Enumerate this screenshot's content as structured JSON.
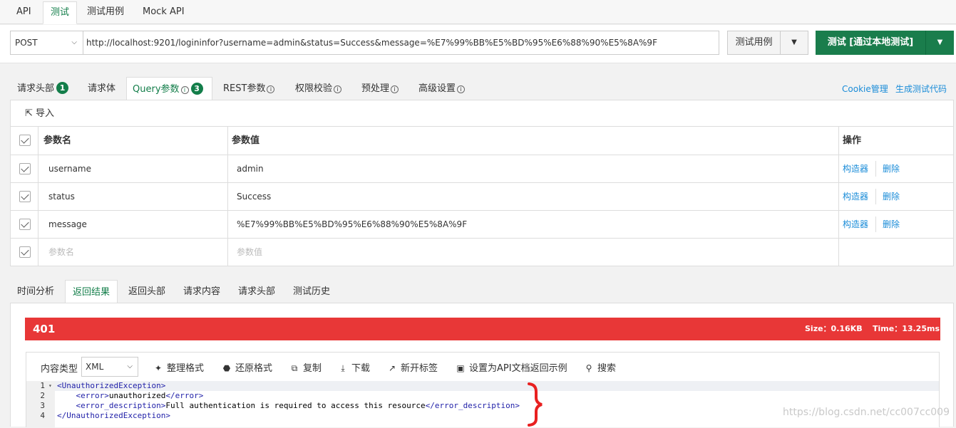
{
  "top_tabs": [
    "API",
    "测试",
    "测试用例",
    "Mock API"
  ],
  "request": {
    "method": "POST",
    "url": "http://localhost:9201/logininfor?username=admin&status=Success&message=%E7%99%BB%E5%BD%95%E6%88%90%E5%8A%9F",
    "test_cases_label": "测试用例",
    "test_button_label": "测试 [通过本地测试]"
  },
  "req_tabs": {
    "headers": "请求头部",
    "headers_count": "1",
    "body": "请求体",
    "query": "Query参数",
    "query_count": "3",
    "rest": "REST参数",
    "auth": "权限校验",
    "preprocess": "预处理",
    "advanced": "高级设置",
    "cookie": "Cookie管理",
    "gen_code": "生成测试代码"
  },
  "params": {
    "import_label": "导入",
    "col_name": "参数名",
    "col_value": "参数值",
    "col_ops": "操作",
    "rows": [
      {
        "name": "username",
        "value": "admin"
      },
      {
        "name": "status",
        "value": "Success"
      },
      {
        "name": "message",
        "value": "%E7%99%BB%E5%BD%95%E6%88%90%E5%8A%9F"
      }
    ],
    "name_placeholder": "参数名",
    "value_placeholder": "参数值",
    "builder_label": "构造器",
    "delete_label": "删除"
  },
  "res_tabs": [
    "时间分析",
    "返回结果",
    "返回头部",
    "请求内容",
    "请求头部",
    "测试历史"
  ],
  "response": {
    "status": "401",
    "size": "Size：0.16KB",
    "time": "Time：13.25ms",
    "status_color": "#e83737",
    "content_type_label": "内容类型",
    "content_type": "XML",
    "tools": {
      "format": "整理格式",
      "restore": "还原格式",
      "copy": "复制",
      "download": "下载",
      "new_tab": "新开标签",
      "set_example": "设置为API文档返回示例",
      "search": "搜索"
    }
  },
  "code": {
    "line_numbers": [
      "1",
      "2",
      "3",
      "4"
    ],
    "l1": "UnauthorizedException",
    "l2_text": "unauthorized",
    "l3_text": "Full authentication is required to access this resource",
    "l4": "UnauthorizedException"
  },
  "watermark": "https://blog.csdn.net/cc007cc009",
  "accent_color": "#137e4a"
}
